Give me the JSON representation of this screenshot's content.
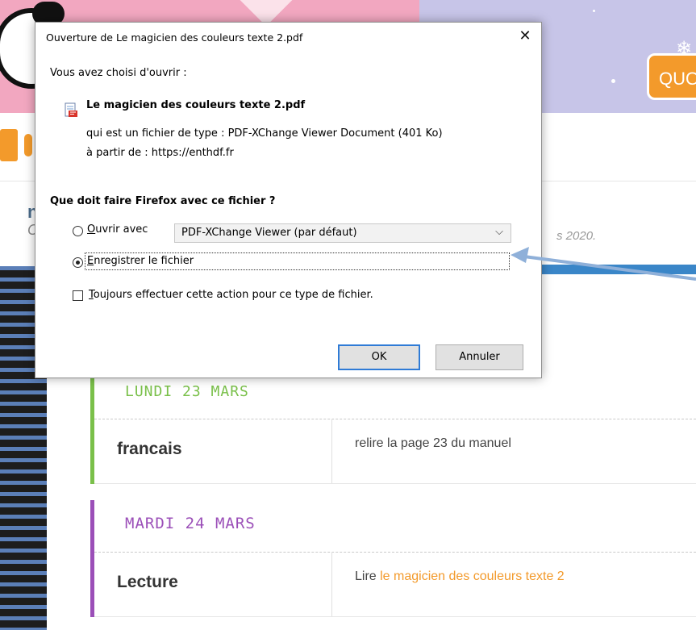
{
  "background": {
    "quick_button_label": "QUO",
    "date_fragment": "s 2020.",
    "heading_fragment": "n",
    "subheading_fragment": "C",
    "days": [
      {
        "title": "LUNDI 23 MARS",
        "subject": "francais",
        "task": "relire la page 23 du manuel",
        "task_link": "",
        "color": "#7ac04a"
      },
      {
        "title": "MARDI 24 MARS",
        "subject": "Lecture",
        "task": "Lire ",
        "task_link": "le magicien des couleurs texte 2",
        "color": "#9b4fb8"
      }
    ]
  },
  "dialog": {
    "title": "Ouverture de Le magicien des couleurs texte 2.pdf",
    "close_label": "✕",
    "intro": "Vous avez choisi d'ouvrir :",
    "file_name": "Le magicien des couleurs texte 2.pdf",
    "type_line": "qui est un fichier de type : PDF-XChange Viewer Document (401 Ko)",
    "source_line": "à partir de : https://enthdf.fr",
    "question": "Que doit faire Firefox avec ce fichier ?",
    "open_with_label_first": "O",
    "open_with_label_rest": "uvrir avec",
    "open_with_app": "PDF-XChange Viewer (par défaut)",
    "save_label_first": "E",
    "save_label_rest": "nregistrer le fichier",
    "always_label_first": "T",
    "always_label_rest": "oujours effectuer cette action pour ce type de fichier.",
    "selected_option": "save",
    "ok_label": "OK",
    "cancel_label": "Annuler"
  },
  "icons": {
    "file": "pdf-file-icon",
    "close": "close-icon",
    "chevron": "chevron-down-icon",
    "arrow": "annotation-arrow"
  },
  "colors": {
    "accent": "#2f7bd6",
    "arrow": "#8fb0d9",
    "orange": "#f39a2b"
  }
}
